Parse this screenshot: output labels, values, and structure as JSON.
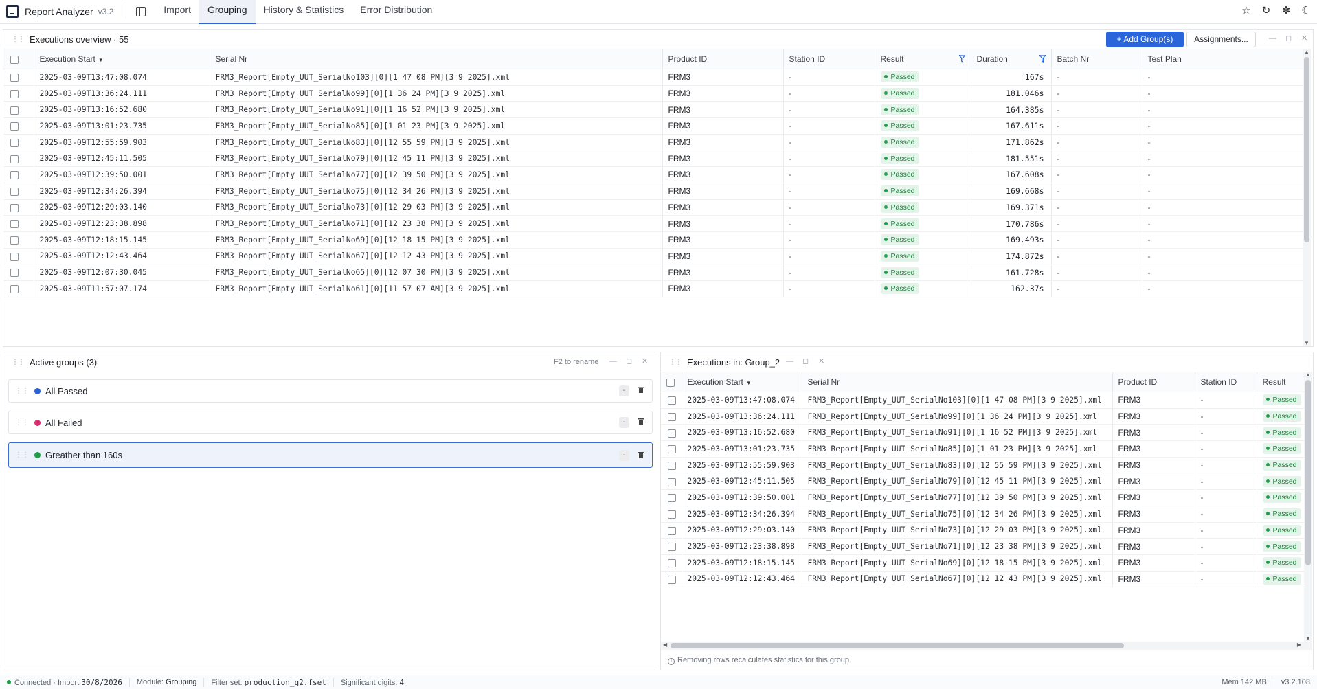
{
  "app": {
    "title": "Report Analyzer",
    "version": "v3.2"
  },
  "tabs": [
    "Import",
    "Grouping",
    "History & Statistics",
    "Error Distribution"
  ],
  "active_tab": "Grouping",
  "top_icons": [
    "star-icon",
    "refresh-icon",
    "settings-icon",
    "theme-icon"
  ],
  "overview": {
    "title": "Executions overview · 55",
    "add_button": "+ Add Group(s)",
    "assign_button": "Assignments...",
    "columns": [
      "Execution Start",
      "Serial Nr",
      "Product ID",
      "Station ID",
      "Result",
      "Duration",
      "Batch Nr",
      "Test Plan"
    ],
    "rows": [
      [
        "2025-03-09T13:47:08.074",
        "FRM3_Report[Empty_UUT_SerialNo103][0][1 47 08 PM][3 9 2025].xml",
        "FRM3",
        "-",
        "Passed",
        "167s",
        "-",
        "-"
      ],
      [
        "2025-03-09T13:36:24.111",
        "FRM3_Report[Empty_UUT_SerialNo99][0][1 36 24 PM][3 9 2025].xml",
        "FRM3",
        "-",
        "Passed",
        "181.046s",
        "-",
        "-"
      ],
      [
        "2025-03-09T13:16:52.680",
        "FRM3_Report[Empty_UUT_SerialNo91][0][1 16 52 PM][3 9 2025].xml",
        "FRM3",
        "-",
        "Passed",
        "164.385s",
        "-",
        "-"
      ],
      [
        "2025-03-09T13:01:23.735",
        "FRM3_Report[Empty_UUT_SerialNo85][0][1 01 23 PM][3 9 2025].xml",
        "FRM3",
        "-",
        "Passed",
        "167.611s",
        "-",
        "-"
      ],
      [
        "2025-03-09T12:55:59.903",
        "FRM3_Report[Empty_UUT_SerialNo83][0][12 55 59 PM][3 9 2025].xml",
        "FRM3",
        "-",
        "Passed",
        "171.862s",
        "-",
        "-"
      ],
      [
        "2025-03-09T12:45:11.505",
        "FRM3_Report[Empty_UUT_SerialNo79][0][12 45 11 PM][3 9 2025].xml",
        "FRM3",
        "-",
        "Passed",
        "181.551s",
        "-",
        "-"
      ],
      [
        "2025-03-09T12:39:50.001",
        "FRM3_Report[Empty_UUT_SerialNo77][0][12 39 50 PM][3 9 2025].xml",
        "FRM3",
        "-",
        "Passed",
        "167.608s",
        "-",
        "-"
      ],
      [
        "2025-03-09T12:34:26.394",
        "FRM3_Report[Empty_UUT_SerialNo75][0][12 34 26 PM][3 9 2025].xml",
        "FRM3",
        "-",
        "Passed",
        "169.668s",
        "-",
        "-"
      ],
      [
        "2025-03-09T12:29:03.140",
        "FRM3_Report[Empty_UUT_SerialNo73][0][12 29 03 PM][3 9 2025].xml",
        "FRM3",
        "-",
        "Passed",
        "169.371s",
        "-",
        "-"
      ],
      [
        "2025-03-09T12:23:38.898",
        "FRM3_Report[Empty_UUT_SerialNo71][0][12 23 38 PM][3 9 2025].xml",
        "FRM3",
        "-",
        "Passed",
        "170.786s",
        "-",
        "-"
      ],
      [
        "2025-03-09T12:18:15.145",
        "FRM3_Report[Empty_UUT_SerialNo69][0][12 18 15 PM][3 9 2025].xml",
        "FRM3",
        "-",
        "Passed",
        "169.493s",
        "-",
        "-"
      ],
      [
        "2025-03-09T12:12:43.464",
        "FRM3_Report[Empty_UUT_SerialNo67][0][12 12 43 PM][3 9 2025].xml",
        "FRM3",
        "-",
        "Passed",
        "174.872s",
        "-",
        "-"
      ],
      [
        "2025-03-09T12:07:30.045",
        "FRM3_Report[Empty_UUT_SerialNo65][0][12 07 30 PM][3 9 2025].xml",
        "FRM3",
        "-",
        "Passed",
        "161.728s",
        "-",
        "-"
      ],
      [
        "2025-03-09T11:57:07.174",
        "FRM3_Report[Empty_UUT_SerialNo61][0][11 57 07 AM][3 9 2025].xml",
        "FRM3",
        "-",
        "Passed",
        "162.37s",
        "-",
        "-"
      ]
    ]
  },
  "groups": {
    "title": "Active groups (3)",
    "hint": "F2 to rename",
    "minus_label": "-",
    "items": [
      {
        "label": "All Passed",
        "color": "#2b63d6"
      },
      {
        "label": "All Failed",
        "color": "#d6306e"
      },
      {
        "label": "Greather than 160s",
        "color": "#1e9e4a"
      }
    ]
  },
  "group_exec": {
    "title": "Executions in: Group_2",
    "columns": [
      "Execution Start",
      "Serial Nr",
      "Product ID",
      "Station ID",
      "Result"
    ],
    "rows": [
      [
        "2025-03-09T13:47:08.074",
        "FRM3_Report[Empty_UUT_SerialNo103][0][1 47 08 PM][3 9 2025].xml",
        "FRM3",
        "-",
        "Passed"
      ],
      [
        "2025-03-09T13:36:24.111",
        "FRM3_Report[Empty_UUT_SerialNo99][0][1 36 24 PM][3 9 2025].xml",
        "FRM3",
        "-",
        "Passed"
      ],
      [
        "2025-03-09T13:16:52.680",
        "FRM3_Report[Empty_UUT_SerialNo91][0][1 16 52 PM][3 9 2025].xml",
        "FRM3",
        "-",
        "Passed"
      ],
      [
        "2025-03-09T13:01:23.735",
        "FRM3_Report[Empty_UUT_SerialNo85][0][1 01 23 PM][3 9 2025].xml",
        "FRM3",
        "-",
        "Passed"
      ],
      [
        "2025-03-09T12:55:59.903",
        "FRM3_Report[Empty_UUT_SerialNo83][0][12 55 59 PM][3 9 2025].xml",
        "FRM3",
        "-",
        "Passed"
      ],
      [
        "2025-03-09T12:45:11.505",
        "FRM3_Report[Empty_UUT_SerialNo79][0][12 45 11 PM][3 9 2025].xml",
        "FRM3",
        "-",
        "Passed"
      ],
      [
        "2025-03-09T12:39:50.001",
        "FRM3_Report[Empty_UUT_SerialNo77][0][12 39 50 PM][3 9 2025].xml",
        "FRM3",
        "-",
        "Passed"
      ],
      [
        "2025-03-09T12:34:26.394",
        "FRM3_Report[Empty_UUT_SerialNo75][0][12 34 26 PM][3 9 2025].xml",
        "FRM3",
        "-",
        "Passed"
      ],
      [
        "2025-03-09T12:29:03.140",
        "FRM3_Report[Empty_UUT_SerialNo73][0][12 29 03 PM][3 9 2025].xml",
        "FRM3",
        "-",
        "Passed"
      ],
      [
        "2025-03-09T12:23:38.898",
        "FRM3_Report[Empty_UUT_SerialNo71][0][12 23 38 PM][3 9 2025].xml",
        "FRM3",
        "-",
        "Passed"
      ],
      [
        "2025-03-09T12:18:15.145",
        "FRM3_Report[Empty_UUT_SerialNo69][0][12 18 15 PM][3 9 2025].xml",
        "FRM3",
        "-",
        "Passed"
      ],
      [
        "2025-03-09T12:12:43.464",
        "FRM3_Report[Empty_UUT_SerialNo67][0][12 12 43 PM][3 9 2025].xml",
        "FRM3",
        "-",
        "Passed"
      ]
    ],
    "footer_note": "Removing rows recalculates statistics for this group."
  },
  "status": {
    "connection": "Connected",
    "import_label": "Import",
    "import_date": "30/8/2026",
    "module_label": "Module:",
    "module": "Grouping",
    "filter_label": "Filter set:",
    "filter": "production_q2.fset",
    "digits_label": "Significant digits:",
    "digits": "4",
    "memory": "Mem 142 MB",
    "version": "v3.2.108"
  }
}
